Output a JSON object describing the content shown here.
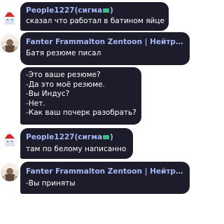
{
  "messages": [
    {
      "author": "People1227(сигма",
      "author_suffix": ")",
      "badge": "green-chip-emoji",
      "lines": [
        "сказал что работал в батином яйце"
      ]
    },
    {
      "author": "Fanter Frammalton Zentoon | Нейтралит...",
      "lines": [
        "Батя резюме писал"
      ]
    },
    {
      "lines": [
        "-Это ваше резюме?",
        "-Да это моё резюме.",
        "-Вы Индус?",
        "-Нет.",
        "-Как ваш почерк разобрать?"
      ]
    },
    {
      "author": "People1227(сигма",
      "author_suffix": ")",
      "badge": "green-chip-emoji",
      "lines": [
        "там по белому написанно"
      ]
    },
    {
      "author": "Fanter Frammalton Zentoon | Нейтралит...",
      "lines": [
        "-Вы приняты"
      ]
    }
  ],
  "colors": {
    "bubble": "#1c1c2b",
    "author": "#a6b8f4",
    "text": "#ffffff",
    "badge": "#3fb88a"
  }
}
